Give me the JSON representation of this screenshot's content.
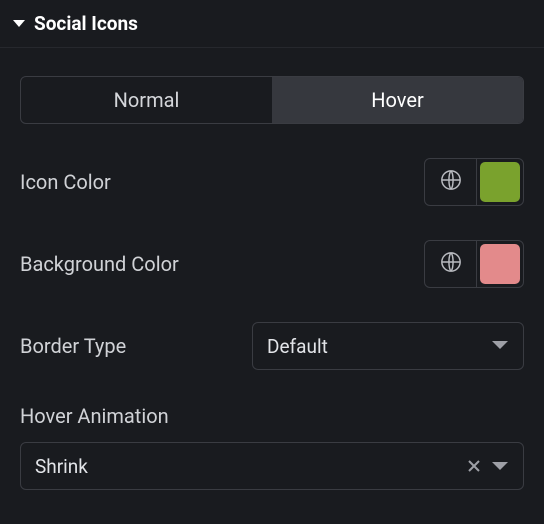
{
  "section": {
    "title": "Social Icons"
  },
  "tabs": {
    "normal": "Normal",
    "hover": "Hover",
    "active": "hover"
  },
  "iconColor": {
    "label": "Icon Color",
    "swatch": "#7aa22d"
  },
  "bgColor": {
    "label": "Background Color",
    "swatch": "#e38a8b"
  },
  "borderType": {
    "label": "Border Type",
    "value": "Default"
  },
  "hoverAnimation": {
    "label": "Hover Animation",
    "value": "Shrink"
  }
}
